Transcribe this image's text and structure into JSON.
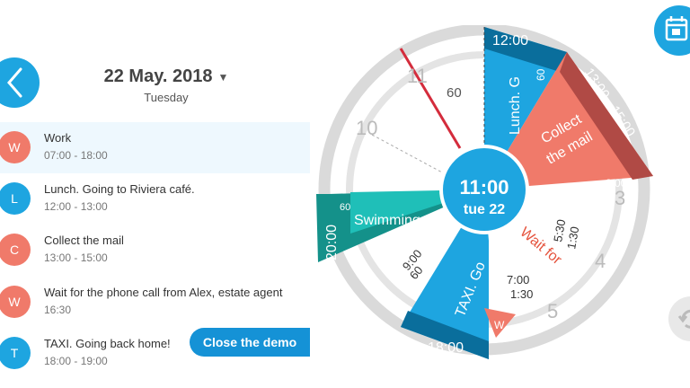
{
  "header": {
    "date": "22 May. 2018",
    "weekday": "Tuesday"
  },
  "events": [
    {
      "initial": "W",
      "title": "Work",
      "time": "07:00  -  18:00",
      "color": "#f07a6a"
    },
    {
      "initial": "L",
      "title": "Lunch. Going to Riviera café.",
      "time": "12:00  -  13:00",
      "color": "#1ea5e0"
    },
    {
      "initial": "C",
      "title": "Collect the mail",
      "time": "13:00  -  15:00",
      "color": "#f07a6a"
    },
    {
      "initial": "W",
      "title": "Wait for the phone call from Alex, estate agent",
      "time": "16:30",
      "color": "#f07a6a"
    },
    {
      "initial": "T",
      "title": "TAXI. Going back home!",
      "time": "18:00  -  19:00",
      "color": "#1ea5e0"
    }
  ],
  "close_demo": "Close the demo",
  "dial": {
    "center_time": "11:00",
    "center_day": "tue 22",
    "hours": [
      "11",
      "10",
      "3",
      "4",
      "5"
    ],
    "lunch": {
      "label": "Lunch. G",
      "start": "12:00",
      "duration": "60"
    },
    "collect": {
      "label1": "Collect",
      "label2": "the mail",
      "range": "13:00 - 15:00",
      "end": "2:00"
    },
    "swimming": {
      "label": "Swimming",
      "start": "20:00",
      "duration": "60"
    },
    "taxi": {
      "label": "TAXI. Go",
      "start": "18:00"
    },
    "wait": {
      "label": "Wait for"
    },
    "minute_60_top": "60",
    "wait_time_a1": "5:30",
    "wait_time_a2": "1:30",
    "wait_time_b1": "7:00",
    "wait_time_b2": "1:30",
    "swim_time_1": "9:00",
    "swim_time_2": "60",
    "w_marker": "W"
  },
  "colors": {
    "accent": "#1ea5e0",
    "coral": "#f07a6a",
    "teal": "#1fbfb8",
    "darkred": "#b04a45",
    "navy": "#0a6e9c"
  }
}
